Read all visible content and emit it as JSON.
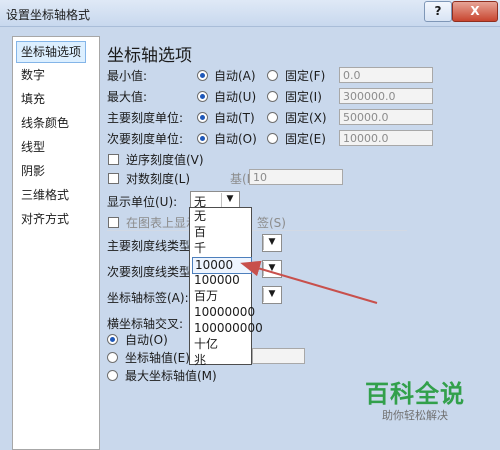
{
  "window": {
    "title": "设置坐标轴格式",
    "help_label": "?",
    "close_label": "X"
  },
  "sidebar": {
    "items": [
      {
        "label": "坐标轴选项"
      },
      {
        "label": "数字"
      },
      {
        "label": "填充"
      },
      {
        "label": "线条颜色"
      },
      {
        "label": "线型"
      },
      {
        "label": "阴影"
      },
      {
        "label": "三维格式"
      },
      {
        "label": "对齐方式"
      }
    ]
  },
  "main": {
    "heading": "坐标轴选项",
    "rows": [
      {
        "label": "最小值:",
        "auto_label": "自动(A)",
        "fixed_label": "固定(F)",
        "value": "0.0"
      },
      {
        "label": "最大值:",
        "auto_label": "自动(U)",
        "fixed_label": "固定(I)",
        "value": "300000.0"
      },
      {
        "label": "主要刻度单位:",
        "auto_label": "自动(T)",
        "fixed_label": "固定(X)",
        "value": "50000.0"
      },
      {
        "label": "次要刻度单位:",
        "auto_label": "自动(O)",
        "fixed_label": "固定(E)",
        "value": "10000.0"
      }
    ],
    "reverse_label": "逆序刻度值(V)",
    "log_label": "对数刻度(L)",
    "base_label": "基(B):",
    "base_value": "10",
    "display_units_label": "显示单位(U):",
    "display_units_value": "无",
    "show_on_chart_prefix": "在图表上显示",
    "show_on_chart_suffix": "签(S)",
    "major_tick_label": "主要刻度线类型",
    "minor_tick_label": "次要刻度线类型",
    "axis_labels_label": "坐标轴标签(A):",
    "cross_heading": "横坐标轴交叉:",
    "cross_auto": "自动(O)",
    "cross_value": "坐标轴值(E)",
    "cross_max": "最大坐标轴值(M)"
  },
  "dropdown": {
    "options": [
      "无",
      "百",
      "千",
      "10000",
      "100000",
      "百万",
      "10000000",
      "100000000",
      "十亿",
      "兆"
    ],
    "highlighted": "10000"
  },
  "watermark": {
    "title": "百科全说",
    "subtitle": "助你轻松解决"
  },
  "colors": {
    "accent": "#1f58b9",
    "arrow": "#c8504c",
    "watermark_green": "#32a04b"
  }
}
